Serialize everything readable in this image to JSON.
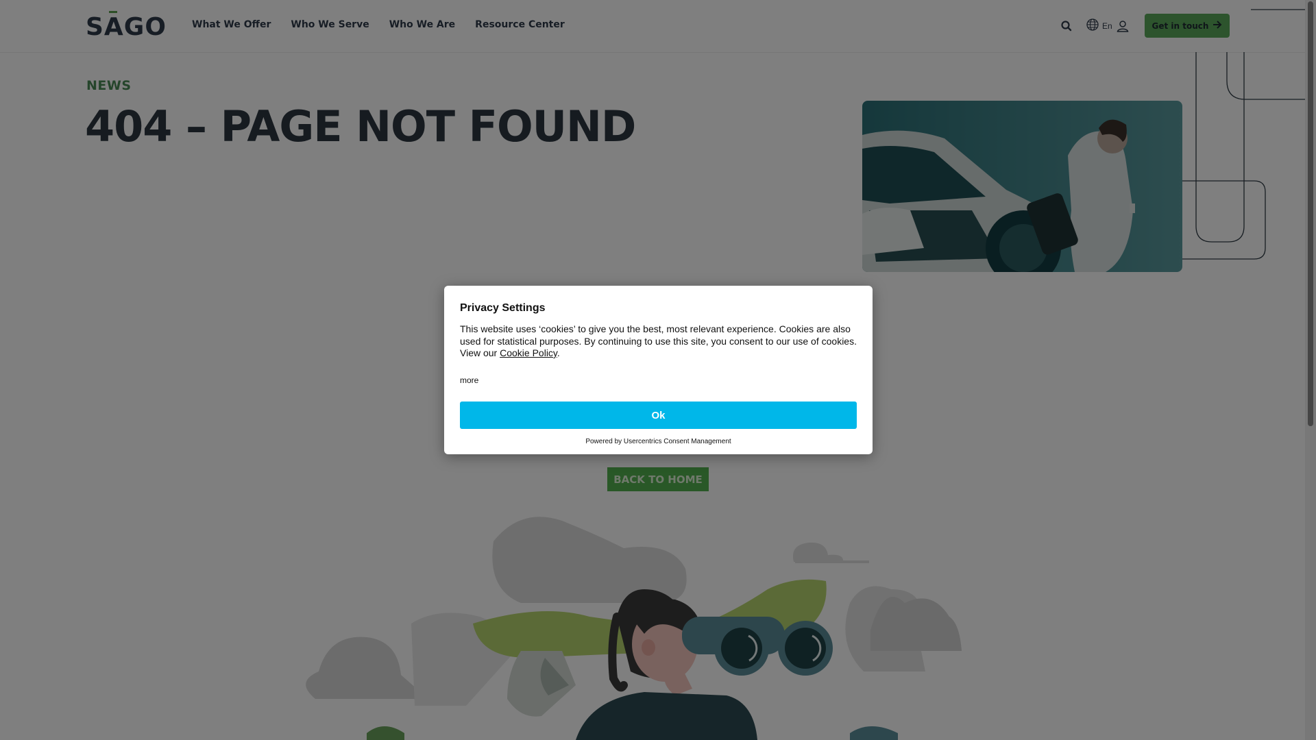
{
  "header": {
    "logo_text": "SAGO",
    "nav": [
      "What We Offer",
      "Who We Serve",
      "Who We Are",
      "Resource Center"
    ],
    "icons": {
      "search": "search-icon",
      "globe": "globe-icon",
      "user": "user-icon",
      "arrow": "arrow-right-icon"
    },
    "language": "En",
    "cta_label": "Get in touch"
  },
  "hero": {
    "eyebrow": "NEWS",
    "title": "404 – PAGE NOT FOUND",
    "back_button": "BACK TO HOME"
  },
  "modal": {
    "title": "Privacy Settings",
    "body_before_link": "This website uses ‘cookies’ to give you the best, most relevant experience. Cookies are also used for statistical purposes. By continuing to use this site, you consent to our use of cookies. View our ",
    "link": "Cookie Policy",
    "body_after_link": ".",
    "more": "more",
    "ok": "Ok",
    "powered_by": "Powered by Usercentrics Consent Management"
  },
  "colors": {
    "brand_green": "#5aa85a",
    "title_dark": "#2d3741",
    "eyebrow_green": "#4a8a56",
    "ok_blue": "#00b7e9",
    "image_teal": "#2f7f86"
  }
}
